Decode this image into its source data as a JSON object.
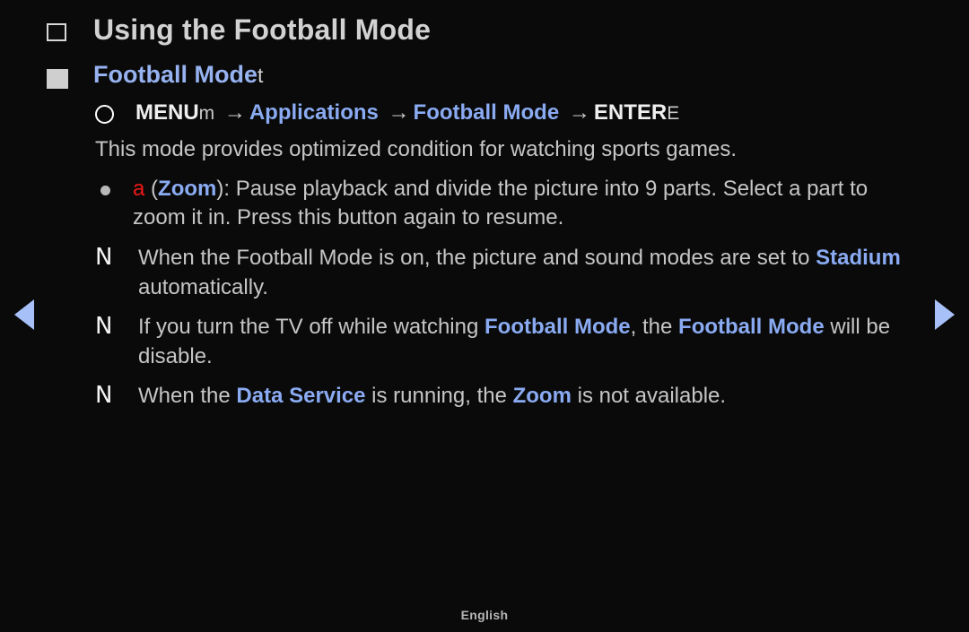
{
  "theme": {
    "background": "#090a09",
    "body_text": "#c6c6c6",
    "title_text": "#d2d2d2",
    "accent_blue": "#8aaaf2",
    "subtitle_blue": "#97b2f0",
    "accent_red": "#f01818",
    "arrow_blue": "#a8c0f8"
  },
  "nav": {
    "prev_label": "previous-page",
    "next_label": "next-page",
    "prev_icon": "triangle-left-icon",
    "next_icon": "triangle-right-icon"
  },
  "header": {
    "bullet_icon": "hollow-square-bullet-icon",
    "title": "Using the Football Mode"
  },
  "subtitle": {
    "bullet_icon": "filled-square-bullet-icon",
    "label": "Football Mode",
    "key_glyph": "t"
  },
  "path": {
    "bullet_icon": "circle-outline-icon",
    "menu_bold": "MENU",
    "menu_key": "m",
    "arrow1": "→",
    "item1": "Applications",
    "arrow2": "→",
    "item2": "Football Mode",
    "arrow3": "→",
    "enter_bold": "ENTER",
    "enter_key": "E"
  },
  "description": "This mode provides optimized condition for watching sports games.",
  "dot_bullet": {
    "bullet_icon": "dot-bullet-icon",
    "key_letter": "a",
    "paren_open": "(",
    "key_name": "Zoom",
    "paren_close": ")",
    "text": ": Pause playback and divide the picture into 9 parts. Select a part to zoom it in. Press this button again to resume."
  },
  "notes": [
    {
      "glyph": "N",
      "icon": "note-marker-icon",
      "part1": "When the Football Mode is on, the picture and sound modes are set to ",
      "highlight1": "Stadium",
      "part2": " automatically.",
      "highlight2": "",
      "part3": ""
    },
    {
      "glyph": "N",
      "icon": "note-marker-icon",
      "part1": "If you turn the TV off while watching ",
      "highlight1": "Football Mode",
      "part2": ", the ",
      "highlight2": "Football Mode",
      "part3": " will be disable."
    },
    {
      "glyph": "N",
      "icon": "note-marker-icon",
      "part1": "When the ",
      "highlight1": "Data Service",
      "part2": " is running, the ",
      "highlight2": "Zoom",
      "part3": " is not available."
    }
  ],
  "footer": {
    "language": "English"
  }
}
